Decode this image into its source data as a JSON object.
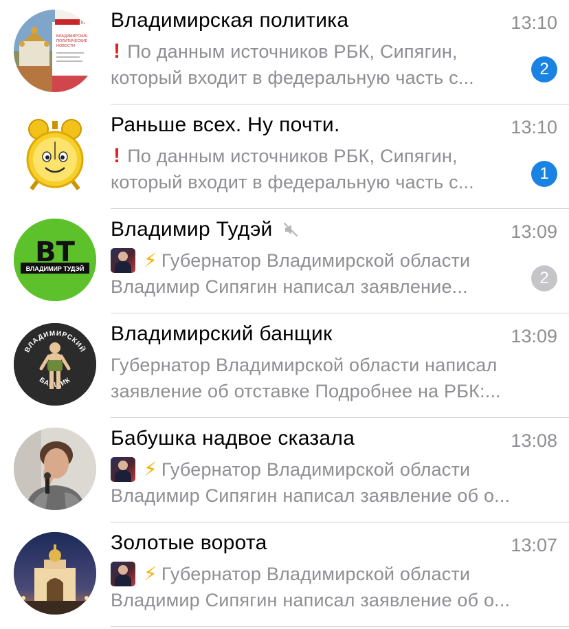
{
  "chats": [
    {
      "title": "Владимирская политика",
      "time": "13:10",
      "preview_line1": "По данным источников РБК, Сипягин,",
      "preview_line2": "который входит в федеральную часть с...",
      "unread": "2",
      "prefix_icon": "red-exclamation-icon",
      "avatar_text": "БУДЬ В КУ.. ВЛАДИМИРСКИЕ ПОЛИТИЧЕСКИЕ НОВОСТИ"
    },
    {
      "title": "Раньше всех. Ну почти.",
      "time": "13:10",
      "preview_line1": "По данным источников РБК, Сипягин,",
      "preview_line2": "который входит в федеральную часть с...",
      "unread": "1",
      "prefix_icon": "red-exclamation-icon"
    },
    {
      "title": "Владимир Тудэй",
      "time": "13:09",
      "preview_line1": "Губернатор Владимирской области",
      "preview_line2": "Владимир Сипягин написал заявление...",
      "unread": "2",
      "muted": true,
      "prefix_icon": "lightning-icon",
      "avatar_logo": "BT",
      "avatar_caption": "ВЛАДИМИР ТУДЭЙ"
    },
    {
      "title": "Владимирский банщик",
      "time": "13:09",
      "preview_line1": "Губернатор Владимирской области написал",
      "preview_line2": "заявление об отставке Подробнее на РБК:...",
      "avatar_top": "ВЛАДИМИРСКИЙ",
      "avatar_bottom": "БАНЩИК"
    },
    {
      "title": "Бабушка надвое сказала",
      "time": "13:08",
      "preview_line1": "Губернатор Владимирской области",
      "preview_line2": "Владимир Сипягин написал заявление об о...",
      "prefix_icon": "lightning-icon"
    },
    {
      "title": "Золотые ворота",
      "time": "13:07",
      "preview_line1": "Губернатор Владимирской области",
      "preview_line2": "Владимир Сипягин написал заявление об о...",
      "prefix_icon": "lightning-icon"
    }
  ],
  "colors": {
    "badge_unmuted": "#1a82e2",
    "badge_muted": "#c4c4c9",
    "secondary_text": "#8e8e93",
    "separator": "#d1d1d6"
  }
}
